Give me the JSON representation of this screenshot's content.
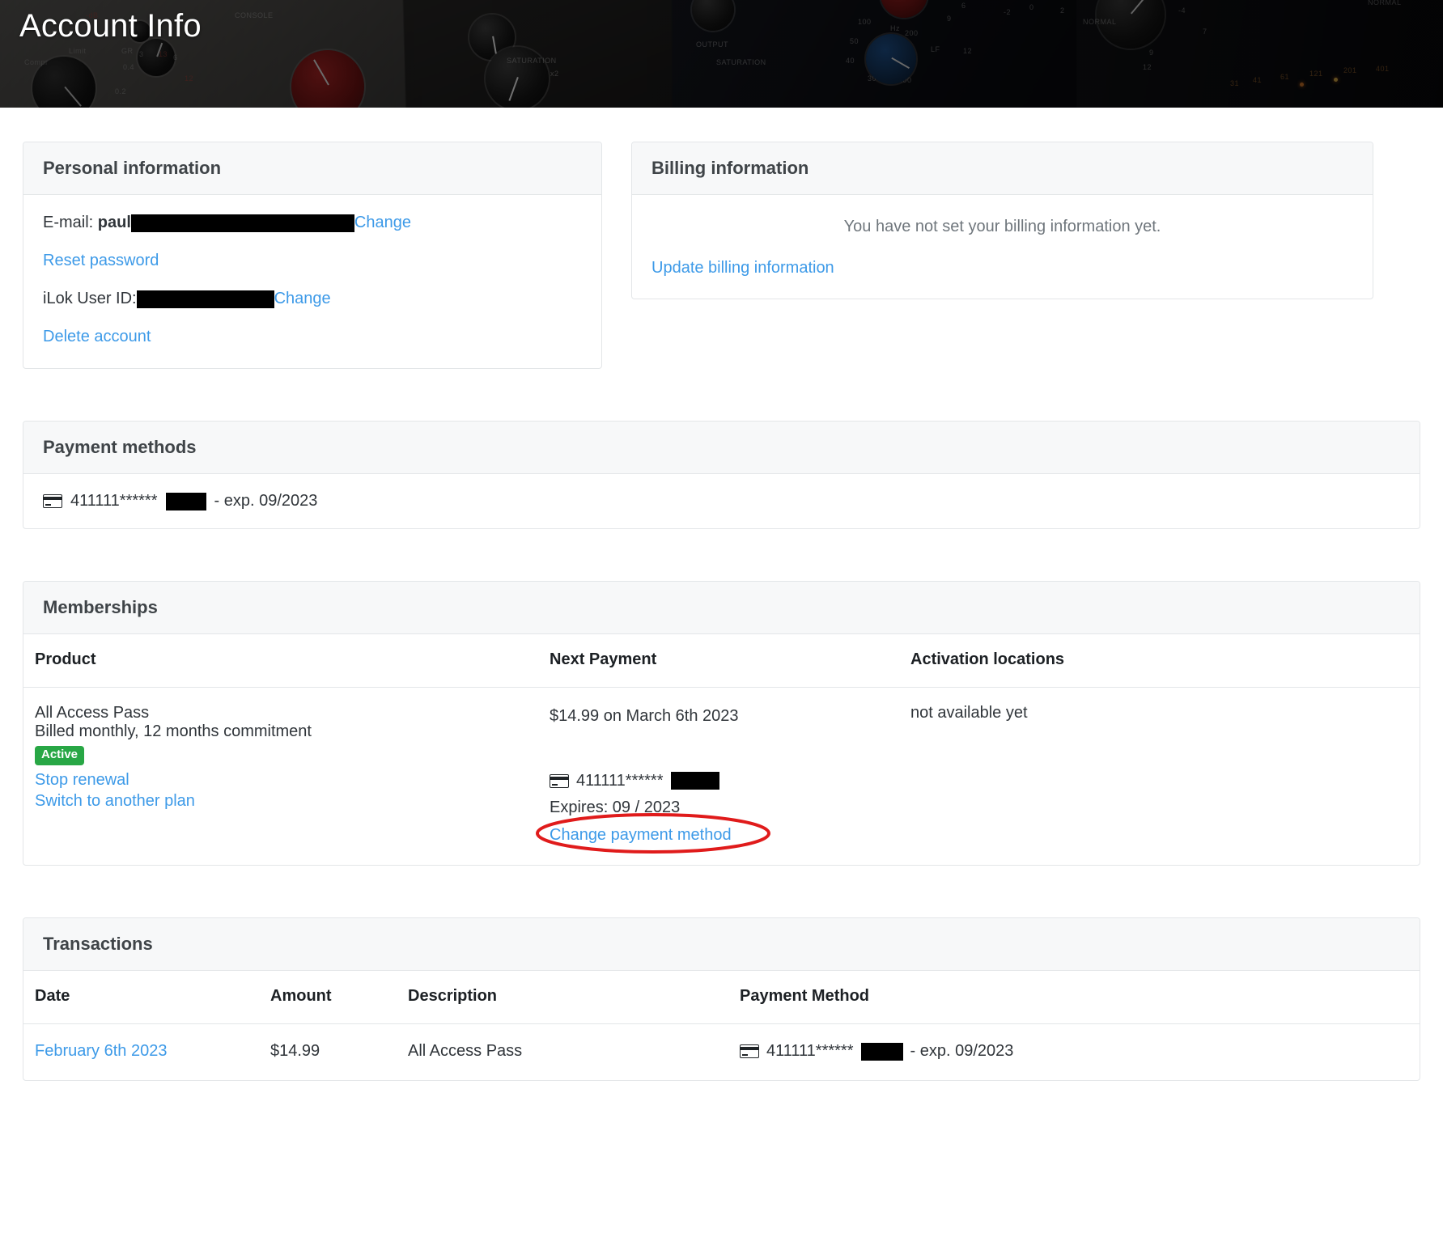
{
  "hero": {
    "title": "Account Info"
  },
  "personal_information": {
    "heading": "Personal information",
    "email_label": "E-mail:",
    "email_value_visible": "paul",
    "email_change_label": "Change",
    "reset_password_label": "Reset password",
    "ilok_label": "iLok User ID:",
    "ilok_change_label": "Change",
    "delete_account_label": "Delete account"
  },
  "billing_information": {
    "heading": "Billing information",
    "empty_message": "You have not set your billing information yet.",
    "update_link_label": "Update billing information"
  },
  "payment_methods": {
    "heading": "Payment methods",
    "card_icon": "credit-card-icon",
    "card_number_masked": "411111******",
    "card_expiry_text": "- exp. 09/2023"
  },
  "memberships": {
    "heading": "Memberships",
    "columns": [
      "Product",
      "Next Payment",
      "Activation locations"
    ],
    "rows": [
      {
        "product_name": "All Access Pass",
        "product_terms": "Billed monthly, 12 months commitment",
        "status_badge": "Active",
        "status_badge_color": "#28a745",
        "actions": [
          "Stop renewal",
          "Switch to another plan"
        ],
        "next_payment_amount": "$14.99 on March 6th 2023",
        "next_payment_card_icon": "credit-card-icon",
        "next_payment_card_masked": "411111******",
        "next_payment_expires": "Expires: 09 / 2023",
        "change_payment_method_label": "Change payment method",
        "activation_locations": "not available yet"
      }
    ],
    "annotation": {
      "shape": "ellipse",
      "color": "#e01b1b",
      "targets": "Change payment method"
    }
  },
  "transactions": {
    "heading": "Transactions",
    "columns": [
      "Date",
      "Amount",
      "Description",
      "Payment Method"
    ],
    "rows": [
      {
        "date": "February 6th 2023",
        "amount": "$14.99",
        "description": "All Access Pass",
        "payment_method_icon": "credit-card-icon",
        "payment_method_masked": "411111******",
        "payment_method_expiry": "- exp. 09/2023"
      }
    ]
  },
  "theme": {
    "link_color": "#3d9ae8",
    "border_color": "#e3e6e8",
    "header_bg": "#f7f8f9",
    "text_color": "#30353a",
    "annotation_red": "#e01b1b"
  }
}
